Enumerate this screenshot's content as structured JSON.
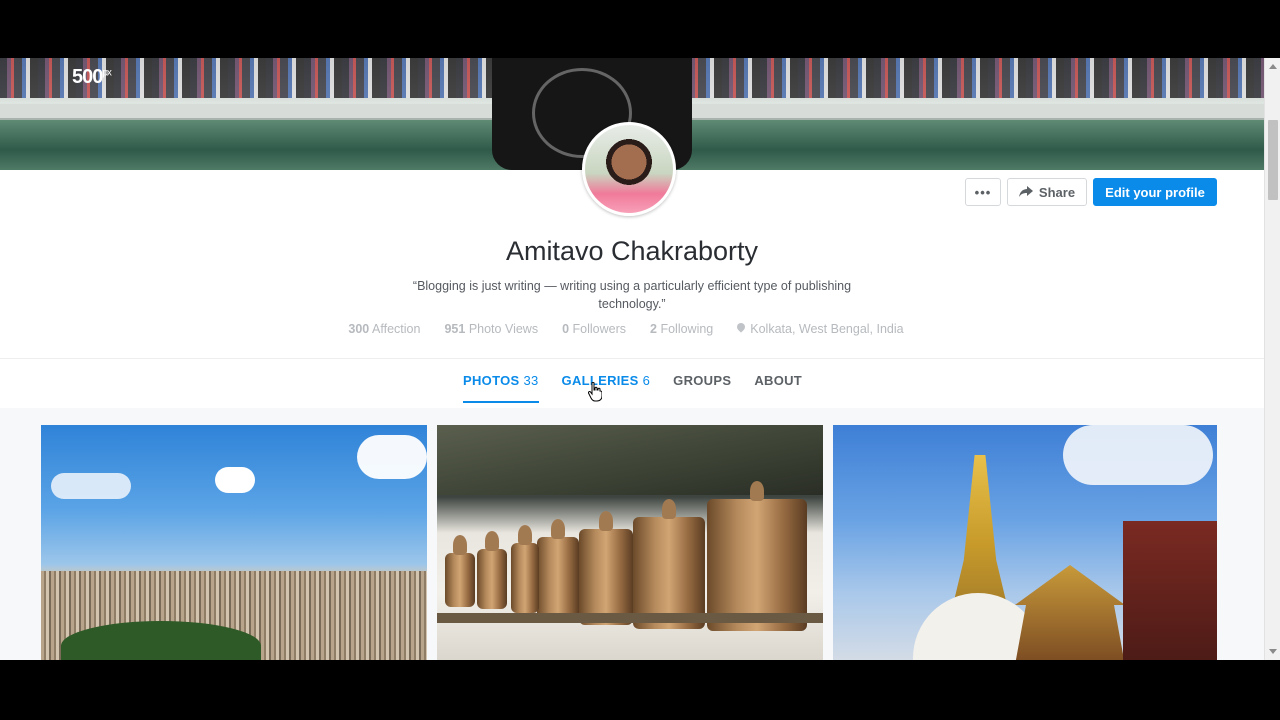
{
  "brand": {
    "logo_text": "500",
    "logo_suffix": "px"
  },
  "profile": {
    "name": "Amitavo Chakraborty",
    "bio": "“Blogging is just writing — writing using a particularly efficient type of publishing technology.”",
    "actions": {
      "more_label": "•••",
      "share_label": "Share",
      "edit_label": "Edit your profile"
    },
    "stats": [
      {
        "value": "300",
        "label": "Affection"
      },
      {
        "value": "951",
        "label": "Photo Views"
      },
      {
        "value": "0",
        "label": "Followers"
      },
      {
        "value": "2",
        "label": "Following"
      }
    ],
    "location": "Kolkata, West Bengal, India"
  },
  "tabs": [
    {
      "label": "PHOTOS",
      "count": "33",
      "active": true
    },
    {
      "label": "GALLERIES",
      "count": "6",
      "active": false
    },
    {
      "label": "GROUPS",
      "count": "",
      "active": false
    },
    {
      "label": "ABOUT",
      "count": "",
      "active": false
    }
  ],
  "icons": {
    "share": "share-arrow-icon",
    "location": "map-pin-icon",
    "cursor": "hand-pointer-icon"
  },
  "colors": {
    "accent": "#0a8bea",
    "muted_text": "#b6babe",
    "heading": "#2a2e33"
  }
}
